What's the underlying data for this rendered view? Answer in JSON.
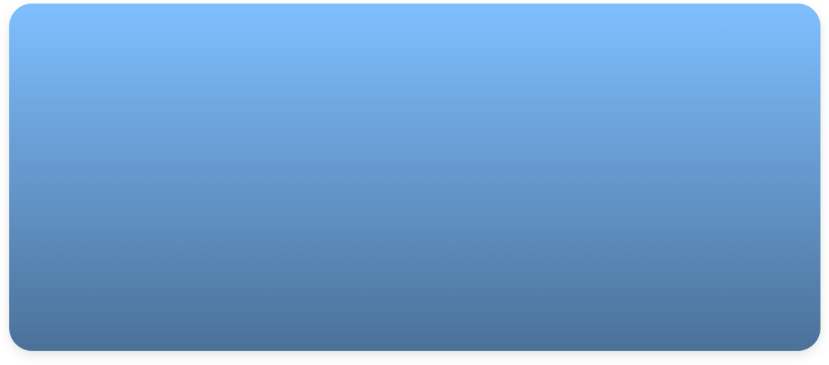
{
  "panel": {
    "gradient_top": "#7fbfff",
    "gradient_bottom": "#4b7199"
  }
}
